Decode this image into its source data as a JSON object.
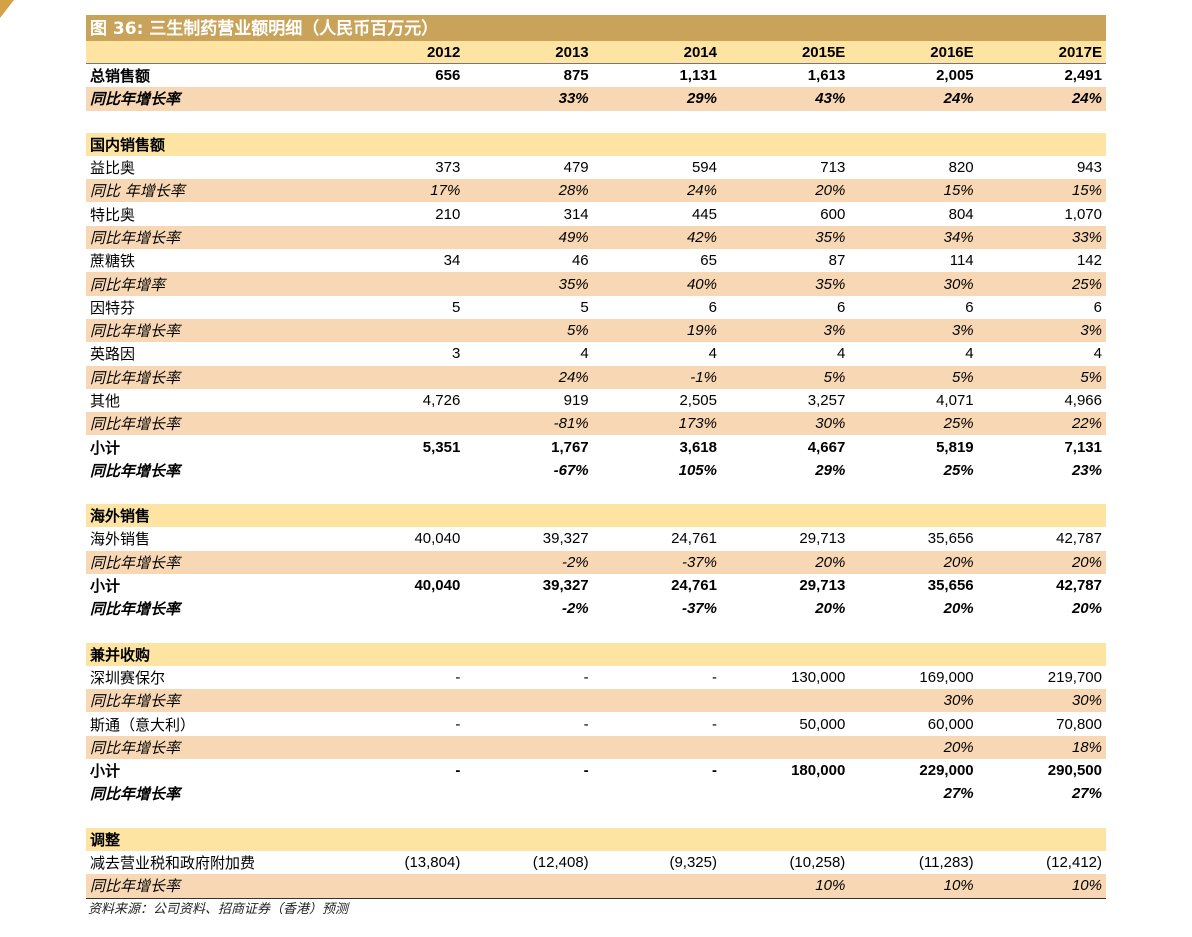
{
  "title": "图 36: 三生制药营业额明细（人民币百万元）",
  "columns": [
    "2012",
    "2013",
    "2014",
    "2015E",
    "2016E",
    "2017E"
  ],
  "rows": [
    {
      "kind": "data",
      "label": "总销售额",
      "values": [
        "656",
        "875",
        "1,131",
        "1,613",
        "2,005",
        "2,491"
      ],
      "bold": true
    },
    {
      "kind": "growth",
      "label": "同比年增长率",
      "values": [
        "",
        "33%",
        "29%",
        "43%",
        "24%",
        "24%"
      ],
      "bold": true,
      "shaded": true
    },
    {
      "kind": "blank",
      "label": "",
      "values": [
        "",
        "",
        "",
        "",
        "",
        ""
      ]
    },
    {
      "kind": "section",
      "label": "国内销售额",
      "values": [
        "",
        "",
        "",
        "",
        "",
        ""
      ]
    },
    {
      "kind": "data",
      "label": "益比奥",
      "values": [
        "373",
        "479",
        "594",
        "713",
        "820",
        "943"
      ]
    },
    {
      "kind": "growth",
      "label": "同比 年增长率",
      "values": [
        "17%",
        "28%",
        "24%",
        "20%",
        "15%",
        "15%"
      ],
      "shaded": true
    },
    {
      "kind": "data",
      "label": "特比奥",
      "values": [
        "210",
        "314",
        "445",
        "600",
        "804",
        "1,070"
      ]
    },
    {
      "kind": "growth",
      "label": "同比年增长率",
      "values": [
        "",
        "49%",
        "42%",
        "35%",
        "34%",
        "33%"
      ],
      "shaded": true
    },
    {
      "kind": "data",
      "label": "蔗糖铁",
      "values": [
        "34",
        "46",
        "65",
        "87",
        "114",
        "142"
      ]
    },
    {
      "kind": "growth",
      "label": "同比年增率",
      "values": [
        "",
        "35%",
        "40%",
        "35%",
        "30%",
        "25%"
      ],
      "shaded": true
    },
    {
      "kind": "data",
      "label": "因特芬",
      "values": [
        "5",
        "5",
        "6",
        "6",
        "6",
        "6"
      ]
    },
    {
      "kind": "growth",
      "label": "同比年增长率",
      "values": [
        "",
        "5%",
        "19%",
        "3%",
        "3%",
        "3%"
      ],
      "shaded": true
    },
    {
      "kind": "data",
      "label": "英路因",
      "values": [
        "3",
        "4",
        "4",
        "4",
        "4",
        "4"
      ]
    },
    {
      "kind": "growth",
      "label": "同比年增长率",
      "values": [
        "",
        "24%",
        "-1%",
        "5%",
        "5%",
        "5%"
      ],
      "shaded": true
    },
    {
      "kind": "data",
      "label": "其他",
      "values": [
        "4,726",
        "919",
        "2,505",
        "3,257",
        "4,071",
        "4,966"
      ]
    },
    {
      "kind": "growth",
      "label": "同比年增长率",
      "values": [
        "",
        "-81%",
        "173%",
        "30%",
        "25%",
        "22%"
      ],
      "shaded": true
    },
    {
      "kind": "data",
      "label": "小计",
      "values": [
        "5,351",
        "1,767",
        "3,618",
        "4,667",
        "5,819",
        "7,131"
      ],
      "bold": true
    },
    {
      "kind": "growth",
      "label": "同比年增长率",
      "values": [
        "",
        "-67%",
        "105%",
        "29%",
        "25%",
        "23%"
      ],
      "bold": true
    },
    {
      "kind": "blank",
      "label": "",
      "values": [
        "",
        "",
        "",
        "",
        "",
        ""
      ]
    },
    {
      "kind": "section",
      "label": "海外销售",
      "values": [
        "",
        "",
        "",
        "",
        "",
        ""
      ]
    },
    {
      "kind": "data",
      "label": "海外销售",
      "values": [
        "40,040",
        "39,327",
        "24,761",
        "29,713",
        "35,656",
        "42,787"
      ]
    },
    {
      "kind": "growth",
      "label": "同比年增长率",
      "values": [
        "",
        "-2%",
        "-37%",
        "20%",
        "20%",
        "20%"
      ],
      "shaded": true
    },
    {
      "kind": "data",
      "label": "小计",
      "values": [
        "40,040",
        "39,327",
        "24,761",
        "29,713",
        "35,656",
        "42,787"
      ],
      "bold": true
    },
    {
      "kind": "growth",
      "label": "同比年增长率",
      "values": [
        "",
        "-2%",
        "-37%",
        "20%",
        "20%",
        "20%"
      ],
      "bold": true
    },
    {
      "kind": "blank",
      "label": "",
      "values": [
        "",
        "",
        "",
        "",
        "",
        ""
      ]
    },
    {
      "kind": "section",
      "label": "兼并收购",
      "values": [
        "",
        "",
        "",
        "",
        "",
        ""
      ]
    },
    {
      "kind": "data",
      "label": "深圳赛保尔",
      "values": [
        "-",
        "-",
        "-",
        "130,000",
        "169,000",
        "219,700"
      ]
    },
    {
      "kind": "growth",
      "label": "同比年增长率",
      "values": [
        "",
        "",
        "",
        "",
        "30%",
        "30%"
      ],
      "shaded": true
    },
    {
      "kind": "data",
      "label": "斯通（意大利）",
      "values": [
        "-",
        "-",
        "-",
        "50,000",
        "60,000",
        "70,800"
      ]
    },
    {
      "kind": "growth",
      "label": "同比年增长率",
      "values": [
        "",
        "",
        "",
        "",
        "20%",
        "18%"
      ],
      "shaded": true
    },
    {
      "kind": "data",
      "label": "小计",
      "values": [
        "-",
        "-",
        "-",
        "180,000",
        "229,000",
        "290,500"
      ],
      "bold": true
    },
    {
      "kind": "growth",
      "label": "同比年增长率",
      "values": [
        "",
        "",
        "",
        "",
        "27%",
        "27%"
      ],
      "bold": true
    },
    {
      "kind": "blank",
      "label": "",
      "values": [
        "",
        "",
        "",
        "",
        "",
        ""
      ]
    },
    {
      "kind": "section",
      "label": "调整",
      "values": [
        "",
        "",
        "",
        "",
        "",
        ""
      ]
    },
    {
      "kind": "data",
      "label": "减去营业税和政府附加费",
      "values": [
        "(13,804)",
        "(12,408)",
        "(9,325)",
        "(10,258)",
        "(11,283)",
        "(12,412)"
      ]
    },
    {
      "kind": "growth",
      "label": "同比年增长率",
      "values": [
        "",
        "",
        "",
        "10%",
        "10%",
        "10%"
      ],
      "shaded": true,
      "last": true
    }
  ],
  "source": "资料来源：公司资料、招商证券（香港）预测"
}
